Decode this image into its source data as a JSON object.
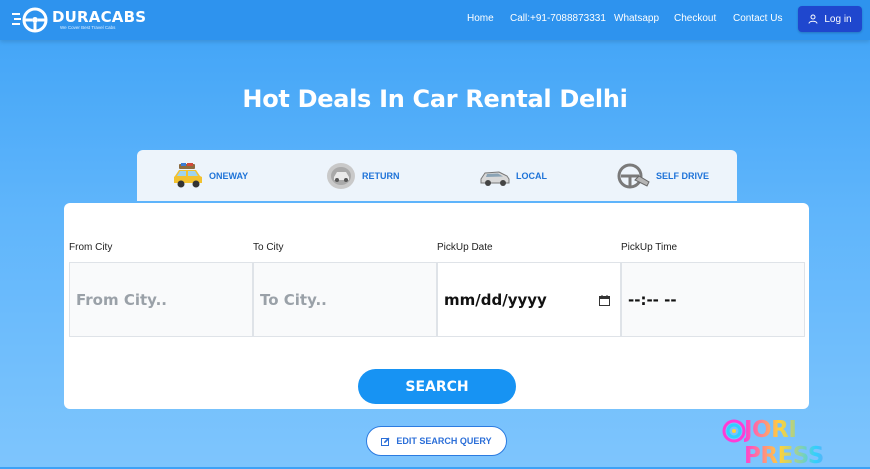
{
  "header": {
    "brand": "DURACABS",
    "tagline": "We Cover Best Travel Cabs",
    "nav": [
      "Home",
      "Call:+91-7088873331",
      "Whatsapp",
      "Checkout",
      "Contact Us"
    ],
    "login_label": "Log in"
  },
  "page_title": "Hot Deals In Car Rental Delhi",
  "tabs": [
    {
      "label": "ONEWAY",
      "icon": "taxi-car-icon",
      "color": "#1e73d8"
    },
    {
      "label": "RETURN",
      "icon": "return-car-icon",
      "color": "#1e73d8"
    },
    {
      "label": "LOCAL",
      "icon": "local-car-icon",
      "color": "#1e73d8"
    },
    {
      "label": "SELF DRIVE",
      "icon": "steering-wheel-icon",
      "color": "#1e73d8"
    }
  ],
  "form": {
    "labels": {
      "from_city": "From City",
      "to_city": "To City",
      "pickup_date": "PickUp Date",
      "pickup_time": "PickUp Time"
    },
    "from_city_placeholder": "From City..",
    "to_city_placeholder": "To City..",
    "pickup_date_value": "mm/dd/yyyy",
    "pickup_time_value": "--:-- --",
    "search_label": "SEARCH"
  },
  "edit_label": "EDIT SEARCH QUERY",
  "watermark": "JORI PRESS",
  "colors": {
    "header": "#2e93ee",
    "login_button": "#1f47ce",
    "search_button": "#1793f3",
    "tab_label": "#1e73d8"
  }
}
